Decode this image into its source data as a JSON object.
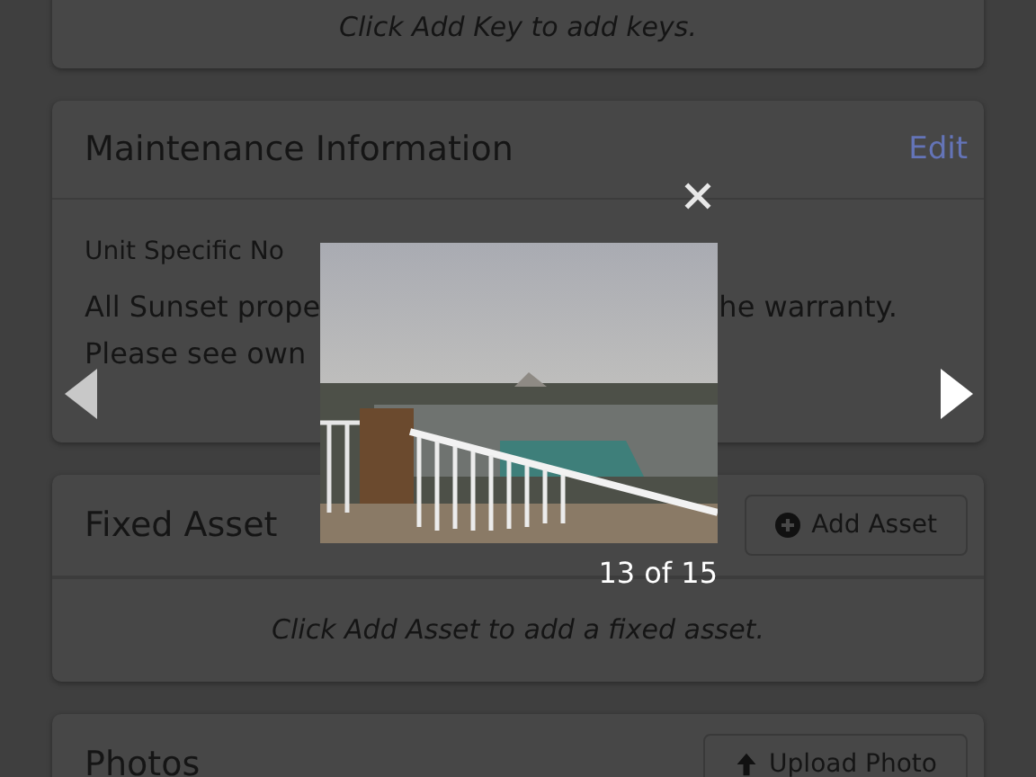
{
  "keys_card": {
    "empty_message": "Click Add Key to add keys."
  },
  "maintenance": {
    "title": "Maintenance Information",
    "edit_link": "Edit",
    "label": "Unit Specific No",
    "lines": [
      {
        "left": "All Sunset prope",
        "right": "he warranty."
      },
      {
        "left": "Please see own"
      }
    ]
  },
  "fixed_asset": {
    "title": "Fixed Asset",
    "button": "Add Asset",
    "empty_message": "Click Add Asset to add a fixed asset."
  },
  "photos": {
    "title": "Photos",
    "button": "Upload Photo"
  },
  "lightbox": {
    "counter": "13 of 15"
  }
}
